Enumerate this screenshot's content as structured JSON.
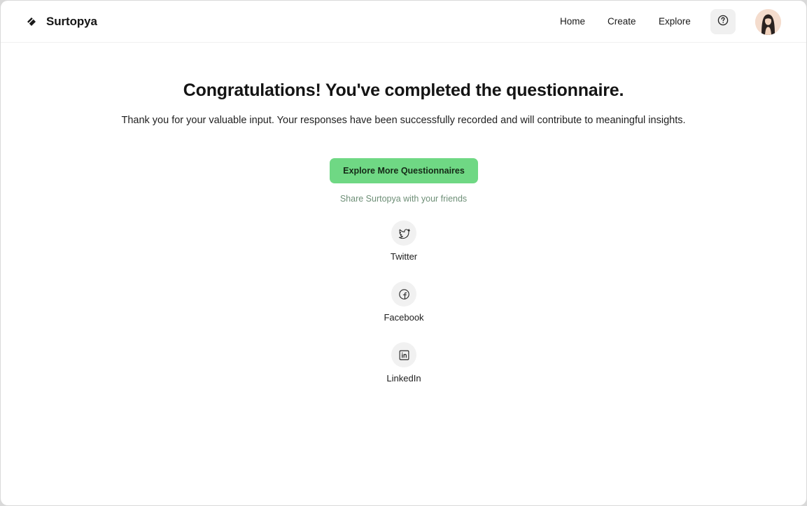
{
  "header": {
    "brand_name": "Surtopya",
    "nav": {
      "home": "Home",
      "create": "Create",
      "explore": "Explore"
    },
    "help_icon": "question-circle-icon",
    "avatar_icon": "user-avatar"
  },
  "main": {
    "title": "Congratulations! You've completed the questionnaire.",
    "subtitle": "Thank you for your valuable input. Your responses have been successfully recorded and will contribute to meaningful insights.",
    "cta_label": "Explore More Questionnaires",
    "share_label": "Share Surtopya with your friends",
    "share_items": [
      {
        "label": "Twitter",
        "icon": "twitter-icon"
      },
      {
        "label": "Facebook",
        "icon": "facebook-icon"
      },
      {
        "label": "LinkedIn",
        "icon": "linkedin-icon"
      }
    ]
  },
  "colors": {
    "accent": "#6fd884",
    "share_label": "#6e8f77",
    "icon_bg": "#f1f1f1"
  }
}
